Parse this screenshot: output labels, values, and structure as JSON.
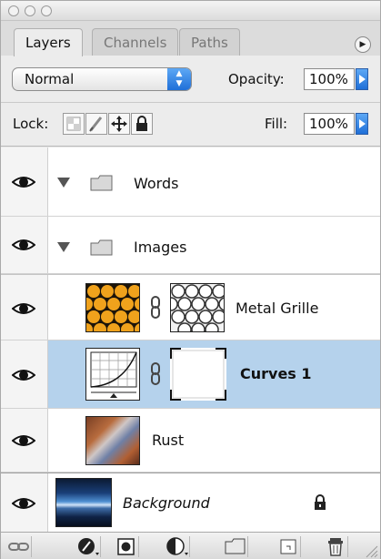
{
  "tabs": [
    {
      "label": "Layers",
      "active": true
    },
    {
      "label": "Channels",
      "active": false
    },
    {
      "label": "Paths",
      "active": false
    }
  ],
  "blend_mode": "Normal",
  "opacity": {
    "label": "Opacity:",
    "value": "100%"
  },
  "lock": {
    "label": "Lock:"
  },
  "fill": {
    "label": "Fill:",
    "value": "100%"
  },
  "layers": [
    {
      "name": "Words",
      "kind": "group",
      "expanded": true,
      "visible": true
    },
    {
      "name": "Images",
      "kind": "group",
      "expanded": true,
      "visible": true
    },
    {
      "name": "Metal Grille",
      "kind": "layer-with-mask",
      "visible": true
    },
    {
      "name": "Curves 1",
      "kind": "adjustment",
      "visible": true,
      "selected": true
    },
    {
      "name": "Rust",
      "kind": "layer",
      "visible": true
    },
    {
      "name": "Background",
      "kind": "background",
      "visible": true,
      "locked": true
    }
  ],
  "colors": {
    "selection": "#b5d2ec",
    "accent": "#1f6fd8"
  },
  "icons": {
    "toolbar": [
      "link-layers-icon",
      "layer-style-icon",
      "add-mask-icon",
      "new-adjustment-layer-icon",
      "new-group-icon",
      "new-layer-icon",
      "delete-layer-icon"
    ]
  }
}
